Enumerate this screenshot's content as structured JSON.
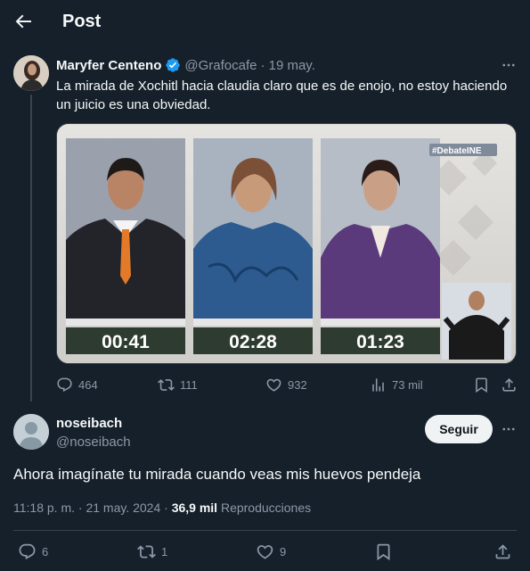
{
  "header": {
    "title": "Post"
  },
  "tweet": {
    "author_name": "Maryfer Centeno",
    "handle": "@Grafocafe",
    "date": "· 19 may.",
    "text": "La mirada de Xochitl hacia claudia claro que es de enojo, no estoy haciendo un juicio es una obviedad.",
    "media": {
      "badge": "#DebateINE",
      "timers": [
        "00:41",
        "02:28",
        "01:23"
      ]
    },
    "stats": {
      "replies": "464",
      "reposts": "111",
      "likes": "932",
      "views": "73 mil"
    }
  },
  "reply": {
    "author_name": "noseibach",
    "handle": "@noseibach",
    "follow_label": "Seguir",
    "text": "Ahora imagínate tu mirada cuando veas mis huevos pendeja",
    "timestamp": "11:18 p. m. · 21 may. 2024 ·",
    "views_count": "36,9 mil",
    "views_label": "Reproducciones",
    "stats": {
      "replies": "6",
      "reposts": "1",
      "likes": "9"
    }
  },
  "colors": {
    "background": "#15202b",
    "muted": "#8b98a5",
    "verified": "#1d9bf0",
    "divider": "#38444d"
  }
}
